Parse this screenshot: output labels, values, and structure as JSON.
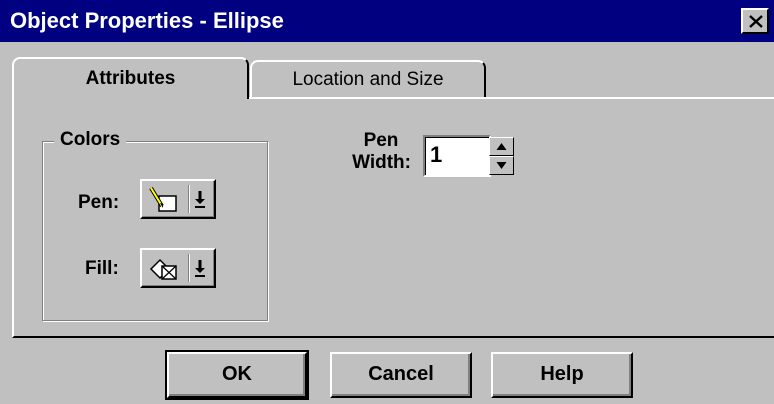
{
  "window": {
    "title": "Object Properties - Ellipse"
  },
  "tabs": [
    {
      "label": "Attributes",
      "active": true
    },
    {
      "label": "Location and Size",
      "active": false
    }
  ],
  "colors_group": {
    "label": "Colors",
    "pen_label": "Pen:",
    "fill_label": "Fill:",
    "pen_icon": "pen-color-icon",
    "fill_icon": "fill-color-icon"
  },
  "pen_width": {
    "label_line1": "Pen",
    "label_line2": "Width:",
    "value": "1"
  },
  "buttons": {
    "ok": "OK",
    "cancel": "Cancel",
    "help": "Help"
  }
}
